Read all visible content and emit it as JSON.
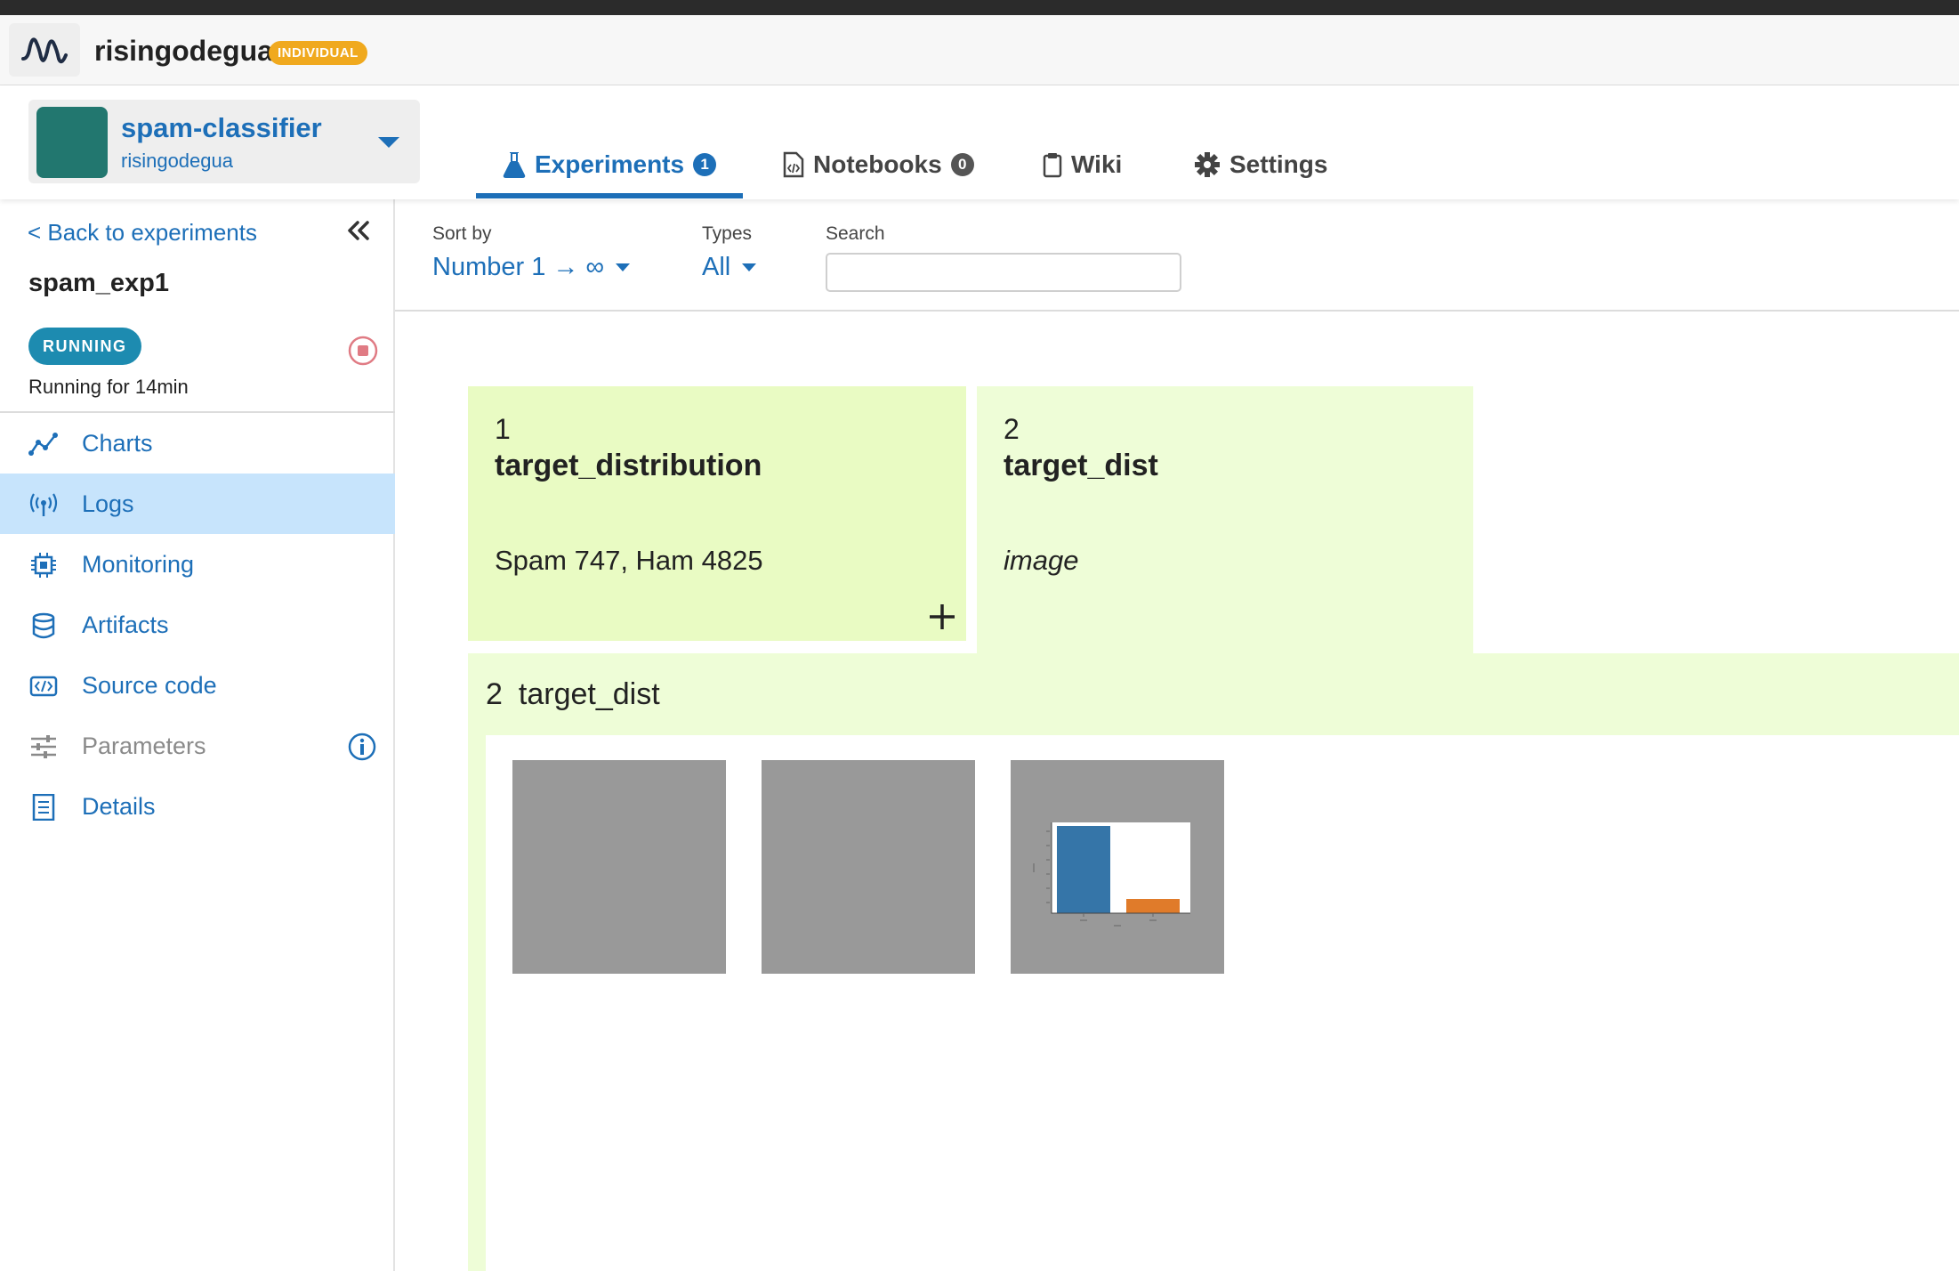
{
  "org": {
    "name": "risingodegua",
    "badge": "INDIVIDUAL",
    "logo_icon": "wave-logo-icon"
  },
  "project": {
    "name": "spam-classifier",
    "owner": "risingodegua",
    "avatar_color": "#22776f"
  },
  "tabs": [
    {
      "label": "Experiments",
      "count": "1",
      "icon": "flask-icon",
      "active": true
    },
    {
      "label": "Notebooks",
      "count": "0",
      "icon": "notebook-icon",
      "active": false
    },
    {
      "label": "Wiki",
      "icon": "clipboard-icon",
      "active": false
    },
    {
      "label": "Settings",
      "icon": "gear-icon",
      "active": false
    }
  ],
  "sidebar": {
    "back_label": "< Back to experiments",
    "experiment_name": "spam_exp1",
    "status": "RUNNING",
    "running_for": "Running for 14min",
    "items": [
      {
        "label": "Charts",
        "icon": "chart-line-icon"
      },
      {
        "label": "Logs",
        "icon": "broadcast-icon",
        "active": true
      },
      {
        "label": "Monitoring",
        "icon": "cpu-chip-icon"
      },
      {
        "label": "Artifacts",
        "icon": "database-icon"
      },
      {
        "label": "Source code",
        "icon": "code-icon"
      },
      {
        "label": "Parameters",
        "icon": "sliders-icon",
        "disabled": true
      },
      {
        "label": "Details",
        "icon": "document-icon"
      }
    ]
  },
  "filters": {
    "sort_label": "Sort by",
    "sort_value": "Number 1 → ∞",
    "types_label": "Types",
    "types_value": "All",
    "search_label": "Search",
    "search_value": "",
    "search_placeholder": ""
  },
  "logs": [
    {
      "number": "1",
      "name": "target_distribution",
      "value": "Spam 747, Ham 4825",
      "color": "#e9fbc3"
    },
    {
      "number": "2",
      "name": "target_dist",
      "value": "image",
      "color": "#eefdd7"
    }
  ],
  "expanded": {
    "number": "2",
    "name": "target_dist",
    "thumbnail_count": 3
  },
  "colors": {
    "accent": "#1d6fb8",
    "active_nav": "#c7e4fc",
    "badge_orange": "#f0a91e",
    "status_running": "#1d8bb0",
    "bar_blue": "#3575a8",
    "bar_orange": "#e07b2a"
  }
}
